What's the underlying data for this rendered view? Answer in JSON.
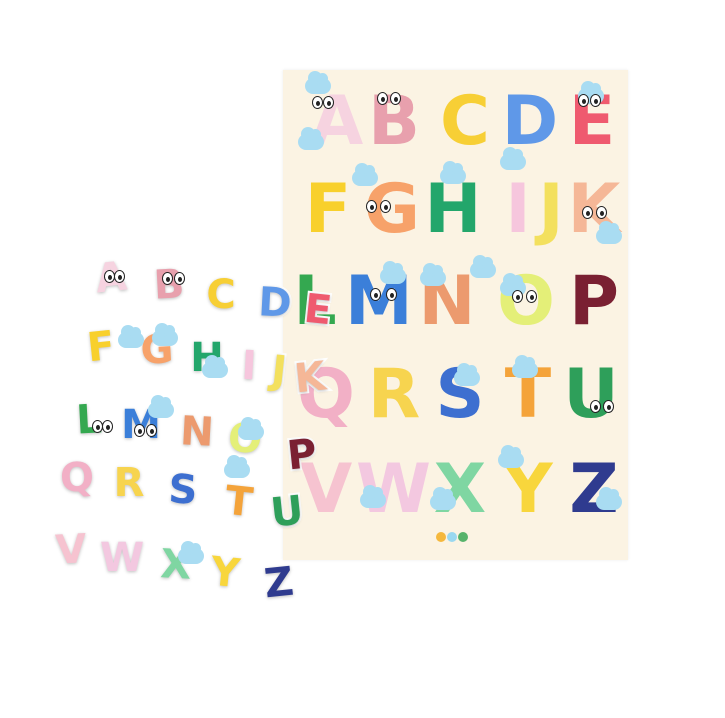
{
  "poster": {
    "letters": [
      {
        "char": "A",
        "color": "#f6d3e0"
      },
      {
        "char": "B",
        "color": "#e8a0ad"
      },
      {
        "char": "C",
        "color": "#f7cf35"
      },
      {
        "char": "D",
        "color": "#5f98e8"
      },
      {
        "char": "E",
        "color": "#ef5a6f"
      },
      {
        "char": "F",
        "color": "#f8d02c"
      },
      {
        "char": "G",
        "color": "#f7a26a"
      },
      {
        "char": "H",
        "color": "#23a66b"
      },
      {
        "char": "I",
        "color": "#f6c6dd"
      },
      {
        "char": "J",
        "color": "#f3e05e"
      },
      {
        "char": "K",
        "color": "#f5b797"
      },
      {
        "char": "L",
        "color": "#34a850"
      },
      {
        "char": "M",
        "color": "#3b7fd9"
      },
      {
        "char": "N",
        "color": "#ec9a6e"
      },
      {
        "char": "O",
        "color": "#e4ef78"
      },
      {
        "char": "P",
        "color": "#7a2032"
      },
      {
        "char": "Q",
        "color": "#f2b0c6"
      },
      {
        "char": "R",
        "color": "#f7d44f"
      },
      {
        "char": "S",
        "color": "#3d6fd0"
      },
      {
        "char": "T",
        "color": "#f4a33a"
      },
      {
        "char": "U",
        "color": "#2e9f5a"
      },
      {
        "char": "V",
        "color": "#f6c3d0"
      },
      {
        "char": "W",
        "color": "#f3c8e0"
      },
      {
        "char": "X",
        "color": "#7fd6a2"
      },
      {
        "char": "Y",
        "color": "#f8d63c"
      },
      {
        "char": "Z",
        "color": "#2f3b8f"
      }
    ]
  },
  "stickers": {
    "letters": [
      {
        "char": "A",
        "color": "#f6d3e0"
      },
      {
        "char": "B",
        "color": "#e8a0ad"
      },
      {
        "char": "C",
        "color": "#f7cf35"
      },
      {
        "char": "D",
        "color": "#5f98e8"
      },
      {
        "char": "E",
        "color": "#ef5a6f"
      },
      {
        "char": "F",
        "color": "#f8d02c"
      },
      {
        "char": "G",
        "color": "#f7a26a"
      },
      {
        "char": "H",
        "color": "#23a66b"
      },
      {
        "char": "I",
        "color": "#f6c6dd"
      },
      {
        "char": "J",
        "color": "#f3e05e"
      },
      {
        "char": "K",
        "color": "#f5b797"
      },
      {
        "char": "L",
        "color": "#34a850"
      },
      {
        "char": "M",
        "color": "#3b7fd9"
      },
      {
        "char": "N",
        "color": "#ec9a6e"
      },
      {
        "char": "O",
        "color": "#e4ef78"
      },
      {
        "char": "P",
        "color": "#7a2032"
      },
      {
        "char": "Q",
        "color": "#f2b0c6"
      },
      {
        "char": "R",
        "color": "#f7d44f"
      },
      {
        "char": "S",
        "color": "#3d6fd0"
      },
      {
        "char": "T",
        "color": "#f4a33a"
      },
      {
        "char": "U",
        "color": "#2e9f5a"
      },
      {
        "char": "V",
        "color": "#f6c3d0"
      },
      {
        "char": "W",
        "color": "#f3c8e0"
      },
      {
        "char": "X",
        "color": "#7fd6a2"
      },
      {
        "char": "Y",
        "color": "#f8d63c"
      },
      {
        "char": "Z",
        "color": "#2f3b8f"
      }
    ]
  },
  "logo": {
    "colors": [
      "#f5b83d",
      "#9ad8f0",
      "#57b36b"
    ]
  }
}
